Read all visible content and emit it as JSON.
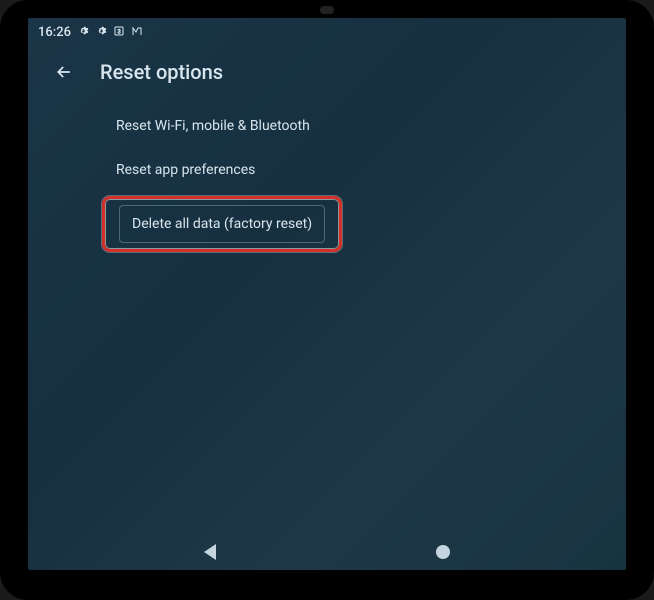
{
  "status_bar": {
    "time": "16:26",
    "icons": [
      "gear",
      "gear",
      "box-3",
      "m-logo"
    ]
  },
  "header": {
    "title": "Reset options"
  },
  "options": [
    {
      "label": "Reset Wi-Fi, mobile & Bluetooth",
      "highlighted": false
    },
    {
      "label": "Reset app preferences",
      "highlighted": false
    },
    {
      "label": "Delete all data (factory reset)",
      "highlighted": true
    }
  ],
  "colors": {
    "highlight_border": "#d43028",
    "screen_bg": "#183340",
    "text": "#d9e6ee"
  }
}
